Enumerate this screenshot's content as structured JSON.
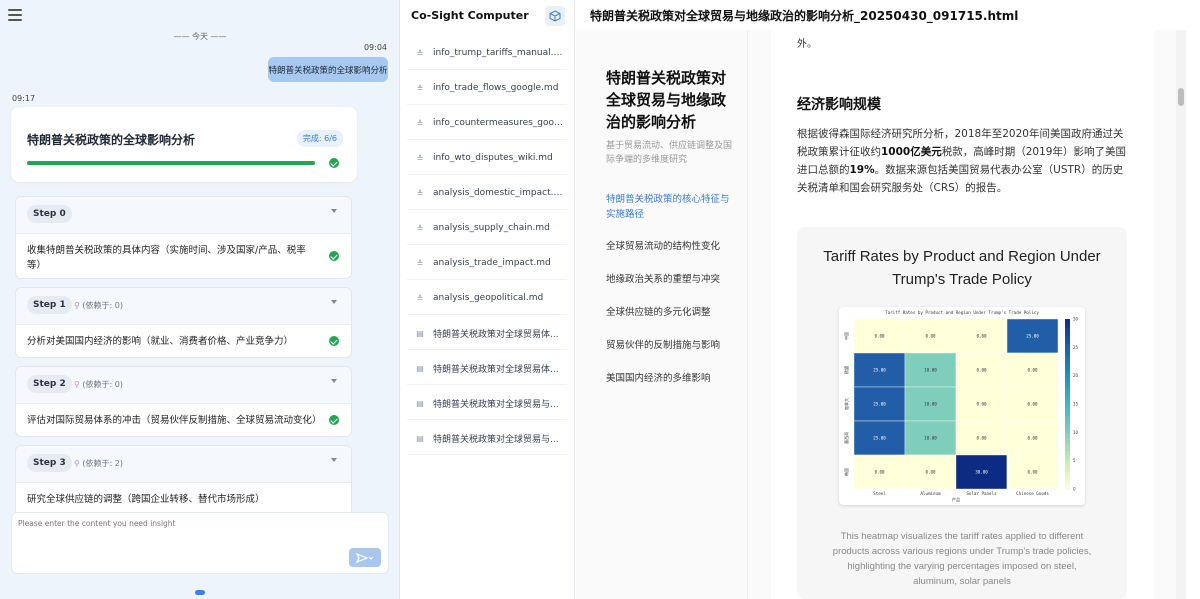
{
  "chat": {
    "date_separator": "—— 今天 ——",
    "user_time": "09:04",
    "user_message": "特朗普关税政策的全球影响分析",
    "reply_time": "09:17",
    "plan": {
      "title": "特朗普关税政策的全球影响分析",
      "status": "完成: 6/6",
      "progress_fraction": 1.0,
      "steps": [
        {
          "label": "Step 0",
          "dependency": "",
          "text": "收集特朗普关税政策的具体内容（实施时间、涉及国家/产品、税率等）",
          "done": true
        },
        {
          "label": "Step 1",
          "dependency": "(依赖于: 0)",
          "text": "分析对美国国内经济的影响（就业、消费者价格、产业竞争力）",
          "done": true
        },
        {
          "label": "Step 2",
          "dependency": "(依赖于: 0)",
          "text": "评估对国际贸易体系的冲击（贸易伙伴反制措施、全球贸易流动变化）",
          "done": true
        },
        {
          "label": "Step 3",
          "dependency": "(依赖于: 2)",
          "text": "研究全球供应链的调整（跨国企业转移、替代市场形成）",
          "done": true
        }
      ]
    },
    "input_placeholder": "Please enter the content you need insight"
  },
  "files": {
    "title": "Co-Sight Computer",
    "items": [
      {
        "name": "info_trump_tariffs_manual.md",
        "icon": "markdown-icon"
      },
      {
        "name": "info_trade_flows_google.md",
        "icon": "markdown-icon"
      },
      {
        "name": "info_countermeasures_googl...",
        "icon": "markdown-icon"
      },
      {
        "name": "info_wto_disputes_wiki.md",
        "icon": "markdown-icon"
      },
      {
        "name": "analysis_domestic_impact.md",
        "icon": "markdown-icon"
      },
      {
        "name": "analysis_supply_chain.md",
        "icon": "markdown-icon"
      },
      {
        "name": "analysis_trade_impact.md",
        "icon": "markdown-icon"
      },
      {
        "name": "analysis_geopolitical.md",
        "icon": "markdown-icon"
      },
      {
        "name": "特朗普关税政策对全球贸易体...",
        "icon": "document-icon"
      },
      {
        "name": "特朗普关税政策对全球贸易体...",
        "icon": "document-icon"
      },
      {
        "name": "特朗普关税政策对全球贸易与...",
        "icon": "document-icon"
      },
      {
        "name": "特朗普关税政策对全球贸易与...",
        "icon": "document-icon"
      }
    ]
  },
  "document": {
    "filename": "特朗普关税政策对全球贸易与地缘政治的影响分析_20250430_091715.html",
    "sidebar_title": "特朗普关税政策对全球贸易与地缘政治的影响分析",
    "sidebar_subtitle": "基于贸易流动、供应链调整及国际争端的多维度研究",
    "toc": [
      "特朗普关税政策的核心特征与实施路径",
      "全球贸易流动的结构性变化",
      "地缘政治关系的重塑与冲突",
      "全球供应链的多元化调整",
      "贸易伙伴的反制措施与影响",
      "美国国内经济的多维影响"
    ],
    "cut_text": "外。",
    "section_heading": "经济影响规模",
    "paragraph_parts": {
      "p1": "根据彼得森国际经济研究所分析，2018年至2020年间美国政府通过关税政策累计征收约",
      "b1": "1000亿美元",
      "p2": "税款，高峰时期（2019年）影响了美国进口总额的",
      "b2": "19%",
      "p3": "。数据来源包括美国贸易代表办公室（USTR）的历史关税清单和国会研究服务处（CRS）的报告。"
    },
    "figure_title": "Tariff Rates by Product and Region Under Trump's Trade Policy",
    "figure_caption": "This heatmap visualizes the tariff rates applied to different products across various regions under Trump's trade policies, highlighting the varying percentages imposed on steel, aluminum, solar panels"
  },
  "chart_data": {
    "type": "heatmap",
    "title": "Tariff Rates by Product and Region Under Trump's Trade Policy",
    "columns": [
      "Steel",
      "Aluminum",
      "Solar Panels",
      "Chinese Goods"
    ],
    "rows": [
      "中国",
      "欧盟",
      "加拿大",
      "墨西哥",
      "韩国"
    ],
    "values": [
      [
        0.0,
        0.0,
        0.0,
        25.0
      ],
      [
        25.0,
        10.0,
        0.0,
        0.0
      ],
      [
        25.0,
        10.0,
        0.0,
        0.0
      ],
      [
        25.0,
        10.0,
        0.0,
        0.0
      ],
      [
        0.0,
        0.0,
        30.0,
        0.0
      ]
    ],
    "colorbar_ticks": [
      0,
      5,
      10,
      15,
      20,
      25,
      30
    ],
    "vmin": 0,
    "vmax": 30,
    "colormap": "YlGnBu",
    "xlabel": "产品"
  },
  "colors": {
    "accent": "#3a7bd5",
    "success": "#22a652",
    "user_bubble": "#a8c8f0"
  }
}
